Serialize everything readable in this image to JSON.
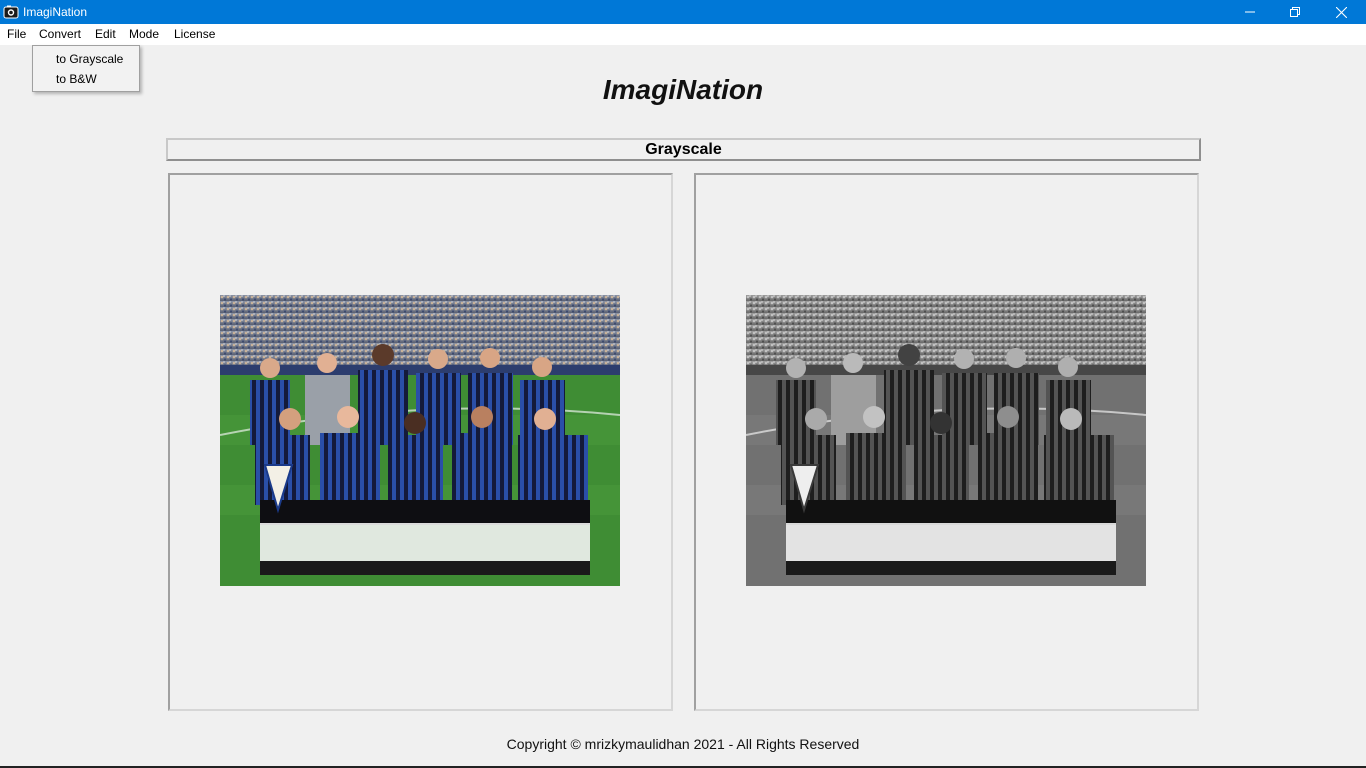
{
  "window": {
    "title": "ImagiNation",
    "icon": "camera-icon",
    "controls": [
      "minimize-icon",
      "restore-icon",
      "close-icon"
    ],
    "accent_color": "#0078d7"
  },
  "menubar": {
    "items": [
      "File",
      "Convert",
      "Edit",
      "Mode",
      "License"
    ]
  },
  "convert_menu": {
    "items": [
      "to Grayscale",
      "to B&W"
    ]
  },
  "main": {
    "heading": "ImagiNation",
    "mode_label": "Grayscale"
  },
  "panels": {
    "original": {
      "image": "team-photo-color"
    },
    "converted": {
      "image": "team-photo-grayscale"
    }
  },
  "footer": {
    "copyright": "Copyright © mrizkymaulidhan 2021 - All Rights Reserved"
  }
}
